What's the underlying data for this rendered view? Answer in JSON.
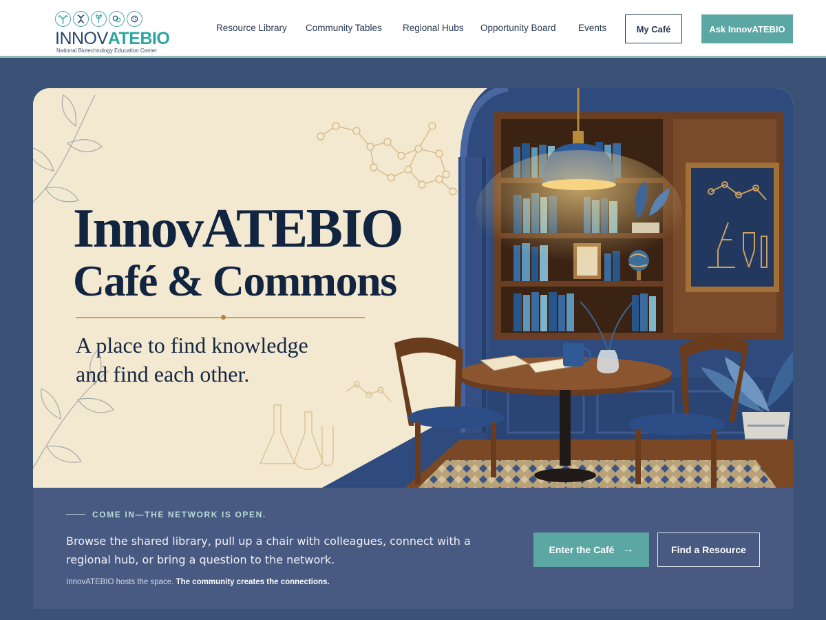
{
  "brand": {
    "word_a": "INNOV",
    "word_b": "ATEBIO",
    "tagline": "National Biotechnology Education Center",
    "color_teal": "#2fa5a1",
    "color_navy": "#27466c",
    "icons": [
      "antibody-icon",
      "dna-icon",
      "seed-icon",
      "cells-icon",
      "microbe-icon"
    ]
  },
  "nav": {
    "items": [
      {
        "label": "Resource Library"
      },
      {
        "label": "Community Tables"
      },
      {
        "label": "Regional Hubs"
      },
      {
        "label": "Opportunity Board"
      },
      {
        "label": "Events"
      }
    ],
    "my_cafe_label": "My Café",
    "ask_label": "Ask InnovATEBIO"
  },
  "hero": {
    "title_line1": "InnovATEBIO",
    "title_line2": "Café & Commons",
    "subtitle_line1": "A place to find knowledge",
    "subtitle_line2": "and find each other."
  },
  "band": {
    "eyebrow": "COME IN—THE NETWORK IS OPEN.",
    "body": "Browse the shared library, pull up a chair with colleagues, connect with a regional hub, or bring a question to the network.",
    "note_plain": "InnovATEBIO hosts the space. ",
    "note_bold": "The community creates the connections.",
    "enter_label": "Enter the Café",
    "enter_arrow": "→",
    "find_label": "Find a Resource"
  },
  "colors": {
    "page_bg": "#3c5176",
    "band_bg": "#485a82",
    "accent_teal": "#5ba7a3",
    "hero_cream": "#f3e8d0",
    "title_navy": "#112440"
  }
}
